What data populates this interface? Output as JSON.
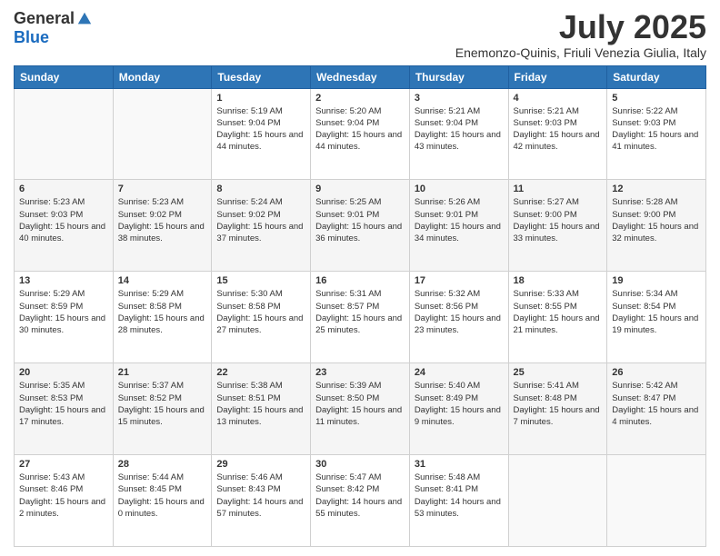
{
  "logo": {
    "general": "General",
    "blue": "Blue"
  },
  "header": {
    "month": "July 2025",
    "location": "Enemonzo-Quinis, Friuli Venezia Giulia, Italy"
  },
  "weekdays": [
    "Sunday",
    "Monday",
    "Tuesday",
    "Wednesday",
    "Thursday",
    "Friday",
    "Saturday"
  ],
  "weeks": [
    [
      {
        "day": "",
        "sunrise": "",
        "sunset": "",
        "daylight": ""
      },
      {
        "day": "",
        "sunrise": "",
        "sunset": "",
        "daylight": ""
      },
      {
        "day": "1",
        "sunrise": "Sunrise: 5:19 AM",
        "sunset": "Sunset: 9:04 PM",
        "daylight": "Daylight: 15 hours and 44 minutes."
      },
      {
        "day": "2",
        "sunrise": "Sunrise: 5:20 AM",
        "sunset": "Sunset: 9:04 PM",
        "daylight": "Daylight: 15 hours and 44 minutes."
      },
      {
        "day": "3",
        "sunrise": "Sunrise: 5:21 AM",
        "sunset": "Sunset: 9:04 PM",
        "daylight": "Daylight: 15 hours and 43 minutes."
      },
      {
        "day": "4",
        "sunrise": "Sunrise: 5:21 AM",
        "sunset": "Sunset: 9:03 PM",
        "daylight": "Daylight: 15 hours and 42 minutes."
      },
      {
        "day": "5",
        "sunrise": "Sunrise: 5:22 AM",
        "sunset": "Sunset: 9:03 PM",
        "daylight": "Daylight: 15 hours and 41 minutes."
      }
    ],
    [
      {
        "day": "6",
        "sunrise": "Sunrise: 5:23 AM",
        "sunset": "Sunset: 9:03 PM",
        "daylight": "Daylight: 15 hours and 40 minutes."
      },
      {
        "day": "7",
        "sunrise": "Sunrise: 5:23 AM",
        "sunset": "Sunset: 9:02 PM",
        "daylight": "Daylight: 15 hours and 38 minutes."
      },
      {
        "day": "8",
        "sunrise": "Sunrise: 5:24 AM",
        "sunset": "Sunset: 9:02 PM",
        "daylight": "Daylight: 15 hours and 37 minutes."
      },
      {
        "day": "9",
        "sunrise": "Sunrise: 5:25 AM",
        "sunset": "Sunset: 9:01 PM",
        "daylight": "Daylight: 15 hours and 36 minutes."
      },
      {
        "day": "10",
        "sunrise": "Sunrise: 5:26 AM",
        "sunset": "Sunset: 9:01 PM",
        "daylight": "Daylight: 15 hours and 34 minutes."
      },
      {
        "day": "11",
        "sunrise": "Sunrise: 5:27 AM",
        "sunset": "Sunset: 9:00 PM",
        "daylight": "Daylight: 15 hours and 33 minutes."
      },
      {
        "day": "12",
        "sunrise": "Sunrise: 5:28 AM",
        "sunset": "Sunset: 9:00 PM",
        "daylight": "Daylight: 15 hours and 32 minutes."
      }
    ],
    [
      {
        "day": "13",
        "sunrise": "Sunrise: 5:29 AM",
        "sunset": "Sunset: 8:59 PM",
        "daylight": "Daylight: 15 hours and 30 minutes."
      },
      {
        "day": "14",
        "sunrise": "Sunrise: 5:29 AM",
        "sunset": "Sunset: 8:58 PM",
        "daylight": "Daylight: 15 hours and 28 minutes."
      },
      {
        "day": "15",
        "sunrise": "Sunrise: 5:30 AM",
        "sunset": "Sunset: 8:58 PM",
        "daylight": "Daylight: 15 hours and 27 minutes."
      },
      {
        "day": "16",
        "sunrise": "Sunrise: 5:31 AM",
        "sunset": "Sunset: 8:57 PM",
        "daylight": "Daylight: 15 hours and 25 minutes."
      },
      {
        "day": "17",
        "sunrise": "Sunrise: 5:32 AM",
        "sunset": "Sunset: 8:56 PM",
        "daylight": "Daylight: 15 hours and 23 minutes."
      },
      {
        "day": "18",
        "sunrise": "Sunrise: 5:33 AM",
        "sunset": "Sunset: 8:55 PM",
        "daylight": "Daylight: 15 hours and 21 minutes."
      },
      {
        "day": "19",
        "sunrise": "Sunrise: 5:34 AM",
        "sunset": "Sunset: 8:54 PM",
        "daylight": "Daylight: 15 hours and 19 minutes."
      }
    ],
    [
      {
        "day": "20",
        "sunrise": "Sunrise: 5:35 AM",
        "sunset": "Sunset: 8:53 PM",
        "daylight": "Daylight: 15 hours and 17 minutes."
      },
      {
        "day": "21",
        "sunrise": "Sunrise: 5:37 AM",
        "sunset": "Sunset: 8:52 PM",
        "daylight": "Daylight: 15 hours and 15 minutes."
      },
      {
        "day": "22",
        "sunrise": "Sunrise: 5:38 AM",
        "sunset": "Sunset: 8:51 PM",
        "daylight": "Daylight: 15 hours and 13 minutes."
      },
      {
        "day": "23",
        "sunrise": "Sunrise: 5:39 AM",
        "sunset": "Sunset: 8:50 PM",
        "daylight": "Daylight: 15 hours and 11 minutes."
      },
      {
        "day": "24",
        "sunrise": "Sunrise: 5:40 AM",
        "sunset": "Sunset: 8:49 PM",
        "daylight": "Daylight: 15 hours and 9 minutes."
      },
      {
        "day": "25",
        "sunrise": "Sunrise: 5:41 AM",
        "sunset": "Sunset: 8:48 PM",
        "daylight": "Daylight: 15 hours and 7 minutes."
      },
      {
        "day": "26",
        "sunrise": "Sunrise: 5:42 AM",
        "sunset": "Sunset: 8:47 PM",
        "daylight": "Daylight: 15 hours and 4 minutes."
      }
    ],
    [
      {
        "day": "27",
        "sunrise": "Sunrise: 5:43 AM",
        "sunset": "Sunset: 8:46 PM",
        "daylight": "Daylight: 15 hours and 2 minutes."
      },
      {
        "day": "28",
        "sunrise": "Sunrise: 5:44 AM",
        "sunset": "Sunset: 8:45 PM",
        "daylight": "Daylight: 15 hours and 0 minutes."
      },
      {
        "day": "29",
        "sunrise": "Sunrise: 5:46 AM",
        "sunset": "Sunset: 8:43 PM",
        "daylight": "Daylight: 14 hours and 57 minutes."
      },
      {
        "day": "30",
        "sunrise": "Sunrise: 5:47 AM",
        "sunset": "Sunset: 8:42 PM",
        "daylight": "Daylight: 14 hours and 55 minutes."
      },
      {
        "day": "31",
        "sunrise": "Sunrise: 5:48 AM",
        "sunset": "Sunset: 8:41 PM",
        "daylight": "Daylight: 14 hours and 53 minutes."
      },
      {
        "day": "",
        "sunrise": "",
        "sunset": "",
        "daylight": ""
      },
      {
        "day": "",
        "sunrise": "",
        "sunset": "",
        "daylight": ""
      }
    ]
  ]
}
